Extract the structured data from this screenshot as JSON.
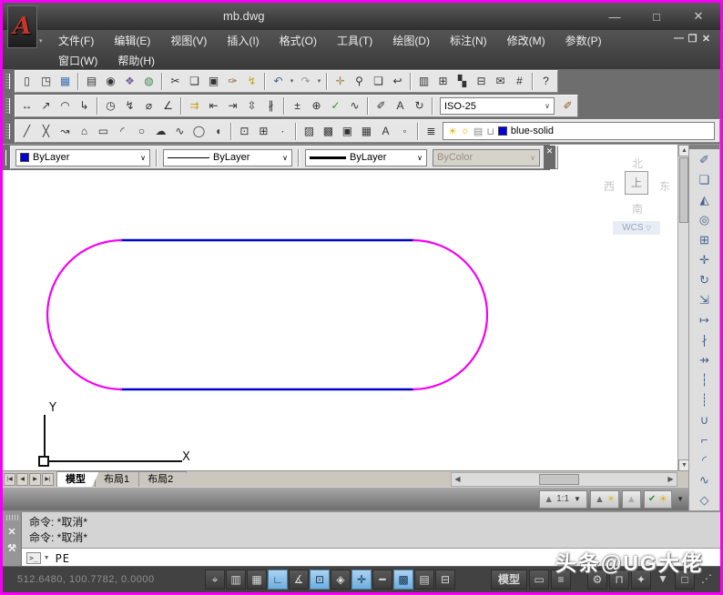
{
  "window": {
    "title": "mb.dwg",
    "logo_letter": "A",
    "logo_dropdown": "▾",
    "minimize": "—",
    "maximize": "□",
    "close": "✕",
    "doc_minimize": "—",
    "doc_restore": "❐",
    "doc_close": "✕"
  },
  "menu": {
    "row1": [
      {
        "name": "menu-file",
        "label": "文件(F)"
      },
      {
        "name": "menu-edit",
        "label": "编辑(E)"
      },
      {
        "name": "menu-view",
        "label": "视图(V)"
      },
      {
        "name": "menu-insert",
        "label": "插入(I)"
      },
      {
        "name": "menu-format",
        "label": "格式(O)"
      },
      {
        "name": "menu-tools",
        "label": "工具(T)"
      },
      {
        "name": "menu-draw",
        "label": "绘图(D)"
      },
      {
        "name": "menu-dimension",
        "label": "标注(N)"
      },
      {
        "name": "menu-modify",
        "label": "修改(M)"
      },
      {
        "name": "menu-parametric",
        "label": "参数(P)"
      }
    ],
    "row2": [
      {
        "name": "menu-window",
        "label": "窗口(W)"
      },
      {
        "name": "menu-help",
        "label": "帮助(H)"
      }
    ]
  },
  "toolbars": {
    "select_chevron": "∨",
    "standard": [
      {
        "name": "new-button",
        "glyph": "▯"
      },
      {
        "name": "open-button",
        "glyph": "◳"
      },
      {
        "name": "save-button",
        "glyph": "▦",
        "color": "#3f6fae"
      },
      {
        "cls": "sep",
        "name": "separator",
        "glyph": ""
      },
      {
        "name": "plot-button",
        "glyph": "▤"
      },
      {
        "name": "plot-preview-button",
        "glyph": "◉"
      },
      {
        "name": "publish-button",
        "glyph": "❖",
        "color": "#7a5fa0"
      },
      {
        "name": "3d-dwf-button",
        "glyph": "◍",
        "color": "#3f8a4f"
      },
      {
        "cls": "sep",
        "name": "separator",
        "glyph": ""
      },
      {
        "name": "cut-button",
        "glyph": "✂"
      },
      {
        "name": "copy-button",
        "glyph": "❏"
      },
      {
        "name": "paste-button",
        "glyph": "▣"
      },
      {
        "name": "match-properties-button",
        "glyph": "✑",
        "color": "#8a5a2a"
      },
      {
        "name": "edit-block-button",
        "glyph": "↯",
        "color": "#c9a227"
      },
      {
        "cls": "sep",
        "name": "separator",
        "glyph": ""
      },
      {
        "name": "undo-button",
        "glyph": "↶",
        "color": "#44618e"
      },
      {
        "name": "undo-dropdown",
        "cls": "narrow",
        "glyph": "▾"
      },
      {
        "name": "redo-button",
        "glyph": "↷",
        "color": "#9a9a9a"
      },
      {
        "name": "redo-dropdown",
        "cls": "narrow",
        "glyph": "▾"
      },
      {
        "cls": "sep",
        "name": "separator",
        "glyph": ""
      },
      {
        "name": "pan-button",
        "glyph": "✛",
        "color": "#a8874f"
      },
      {
        "name": "zoom-realtime-button",
        "glyph": "⚲"
      },
      {
        "name": "zoom-window-button",
        "glyph": "❑"
      },
      {
        "name": "zoom-previous-button",
        "glyph": "↩"
      },
      {
        "cls": "sep",
        "name": "separator",
        "glyph": ""
      },
      {
        "name": "properties-button",
        "glyph": "▥"
      },
      {
        "name": "designcenter-button",
        "glyph": "⊞"
      },
      {
        "name": "tool-palettes-button",
        "glyph": "▚"
      },
      {
        "name": "sheet-set-manager-button",
        "glyph": "⊟"
      },
      {
        "name": "markup-set-manager-button",
        "glyph": "✉"
      },
      {
        "name": "quickcalc-button",
        "glyph": "#"
      },
      {
        "cls": "sep",
        "name": "separator",
        "glyph": ""
      },
      {
        "name": "help-button",
        "glyph": "?"
      }
    ],
    "dimension": [
      {
        "name": "linear-dimension-button",
        "glyph": "↔"
      },
      {
        "name": "aligned-dimension-button",
        "glyph": "↗"
      },
      {
        "name": "arc-length-dimension-button",
        "glyph": "◠"
      },
      {
        "name": "ordinate-dimension-button",
        "glyph": "↳"
      },
      {
        "cls": "sep",
        "name": "separator",
        "glyph": ""
      },
      {
        "name": "radius-dimension-button",
        "glyph": "◷"
      },
      {
        "name": "jogged-dimension-button",
        "glyph": "↯"
      },
      {
        "name": "diameter-dimension-button",
        "glyph": "⌀"
      },
      {
        "name": "angular-dimension-button",
        "glyph": "∠"
      },
      {
        "cls": "sep",
        "name": "separator",
        "glyph": ""
      },
      {
        "name": "quick-dimension-button",
        "glyph": "⇉",
        "color": "#c9a227"
      },
      {
        "name": "baseline-dimension-button",
        "glyph": "⇤"
      },
      {
        "name": "continue-dimension-button",
        "glyph": "⇥"
      },
      {
        "name": "dimension-space-button",
        "glyph": "⇳"
      },
      {
        "name": "dimension-break-button",
        "glyph": "∦"
      },
      {
        "cls": "sep",
        "name": "separator",
        "glyph": ""
      },
      {
        "name": "tolerance-button",
        "glyph": "±"
      },
      {
        "name": "center-mark-button",
        "glyph": "⊕"
      },
      {
        "name": "inspection-button",
        "glyph": "✓",
        "color": "#2f8f2f"
      },
      {
        "name": "jogged-linear-button",
        "glyph": "∿"
      },
      {
        "cls": "sep",
        "name": "separator",
        "glyph": ""
      },
      {
        "name": "dimension-edit-button",
        "glyph": "✐"
      },
      {
        "name": "dimension-text-edit-button",
        "glyph": "A"
      },
      {
        "name": "dimension-update-button",
        "glyph": "↻"
      },
      {
        "cls": "sep",
        "name": "separator",
        "glyph": ""
      }
    ],
    "dimension_style": "ISO-25",
    "dimension_style_button": "✐",
    "draw": [
      {
        "name": "line-button",
        "glyph": "╱"
      },
      {
        "name": "construction-line-button",
        "glyph": "╳"
      },
      {
        "name": "polyline-button",
        "glyph": "↝"
      },
      {
        "name": "polygon-button",
        "glyph": "⌂"
      },
      {
        "name": "rectangle-button",
        "glyph": "▭"
      },
      {
        "name": "arc-button",
        "glyph": "◜"
      },
      {
        "name": "circle-button",
        "glyph": "○"
      },
      {
        "name": "revision-cloud-button",
        "glyph": "☁"
      },
      {
        "name": "spline-button",
        "glyph": "∿"
      },
      {
        "name": "ellipse-button",
        "glyph": "◯"
      },
      {
        "name": "ellipse-arc-button",
        "glyph": "◖"
      },
      {
        "cls": "sep",
        "name": "separator",
        "glyph": ""
      },
      {
        "name": "insert-block-button",
        "glyph": "⊡"
      },
      {
        "name": "make-block-button",
        "glyph": "⊞"
      },
      {
        "name": "point-button",
        "glyph": "∙"
      },
      {
        "cls": "sep",
        "name": "separator",
        "glyph": ""
      },
      {
        "name": "hatch-button",
        "glyph": "▨"
      },
      {
        "name": "gradient-button",
        "glyph": "▩"
      },
      {
        "name": "region-button",
        "glyph": "▣"
      },
      {
        "name": "table-button",
        "glyph": "▦"
      },
      {
        "name": "multiline-text-button",
        "glyph": "A"
      },
      {
        "name": "point-style-button",
        "glyph": "◦"
      }
    ],
    "layers": {
      "manager_glyph": "≣",
      "on_glyph": "☀",
      "thaw_glyph": "☼",
      "plot_glyph": "▤",
      "lock_glyph": "⊔",
      "swatch": "#0000dd",
      "value": "blue-solid"
    },
    "properties": {
      "color_swatch": "#0000dd",
      "color_value": "ByLayer",
      "linetype_value": "ByLayer",
      "lineweight_value": "ByLayer",
      "plotstyle_value": "ByColor",
      "close_glyph": "✕"
    },
    "modify": [
      {
        "name": "erase-button",
        "glyph": "✐"
      },
      {
        "name": "copy-button",
        "glyph": "❏"
      },
      {
        "name": "mirror-button",
        "glyph": "◭"
      },
      {
        "name": "offset-button",
        "glyph": "◎"
      },
      {
        "name": "array-button",
        "glyph": "⊞"
      },
      {
        "name": "move-button",
        "glyph": "✛"
      },
      {
        "name": "rotate-button",
        "glyph": "↻"
      },
      {
        "name": "scale-button",
        "glyph": "⇲"
      },
      {
        "name": "stretch-button",
        "glyph": "↦"
      },
      {
        "name": "trim-button",
        "glyph": "∤"
      },
      {
        "name": "extend-button",
        "glyph": "⇸"
      },
      {
        "name": "break-at-point-button",
        "glyph": "┆"
      },
      {
        "name": "break-button",
        "glyph": "┊"
      },
      {
        "name": "join-button",
        "glyph": "∪"
      },
      {
        "name": "chamfer-button",
        "glyph": "⌐"
      },
      {
        "name": "fillet-button",
        "glyph": "◜"
      },
      {
        "name": "blend-curves-button",
        "glyph": "∿"
      },
      {
        "name": "explode-button",
        "glyph": "◇"
      }
    ]
  },
  "viewcube": {
    "north": "北",
    "west": "西",
    "top": "上",
    "east": "东",
    "south": "南",
    "wcs": "WCS",
    "wcs_arrow": "▽"
  },
  "ucs": {
    "x_label": "X",
    "y_label": "Y"
  },
  "tabs": {
    "nav": [
      {
        "name": "tab-first-button",
        "glyph": "|◀"
      },
      {
        "name": "tab-prev-button",
        "glyph": "◀"
      },
      {
        "name": "tab-next-button",
        "glyph": "▶"
      },
      {
        "name": "tab-last-button",
        "glyph": "▶|"
      }
    ],
    "items": [
      {
        "name": "tab-model",
        "label": "模型",
        "active": true
      },
      {
        "name": "tab-layout1",
        "label": "布局1"
      },
      {
        "name": "tab-layout2",
        "label": "布局2"
      }
    ]
  },
  "scrollbars": {
    "up": "▲",
    "down": "▼",
    "left": "◀",
    "right": "▶"
  },
  "annotation": {
    "scale_icon": "▲",
    "scale": "1:1",
    "dropdown": "▼",
    "visibility_icon": "▲",
    "visibility_bulb": "☀",
    "autoscale_icon": "▲",
    "layer_check": "✔",
    "layer_bulb": "☀",
    "menu_arrow": "▼"
  },
  "command": {
    "close_glyph": "✕",
    "tool_glyph": "⚒",
    "history": [
      "命令: *取消*",
      "命令: *取消*"
    ],
    "prompt": ">_",
    "dropdown": "▼",
    "input": "PE"
  },
  "status": {
    "coordinates": "512.6480, 100.7782, 0.0000",
    "toggles": [
      {
        "name": "infer-constraints-toggle",
        "glyph": "⌖"
      },
      {
        "name": "snap-toggle",
        "glyph": "▥"
      },
      {
        "name": "grid-toggle",
        "glyph": "▦"
      },
      {
        "name": "ortho-toggle",
        "glyph": "∟",
        "active": true
      },
      {
        "name": "polar-tracking-toggle",
        "glyph": "∡"
      },
      {
        "name": "object-snap-toggle",
        "glyph": "⊡",
        "active": true
      },
      {
        "name": "3d-object-snap-toggle",
        "glyph": "◈"
      },
      {
        "name": "dynamic-input-toggle",
        "glyph": "✛",
        "active": true
      },
      {
        "name": "lineweight-toggle",
        "glyph": "━"
      },
      {
        "name": "transparency-toggle",
        "glyph": "▩",
        "active": true
      },
      {
        "name": "quick-properties-toggle",
        "glyph": "▤"
      },
      {
        "name": "selection-cycling-toggle",
        "glyph": "⊟"
      }
    ],
    "right": [
      {
        "name": "model-space-button",
        "glyph": "模型",
        "cls": "txt"
      },
      {
        "name": "annotation-monitor-button",
        "glyph": "▭"
      },
      {
        "name": "tray-settings-button",
        "glyph": "≡"
      },
      {
        "name": "workspace-switching-button",
        "glyph": "⚙",
        "cls": "gapL"
      },
      {
        "name": "toolbar-lock-button",
        "glyph": "⊓"
      },
      {
        "name": "hardware-acceleration-button",
        "glyph": "✦"
      },
      {
        "name": "status-menu-button",
        "glyph": "▼",
        "cls": "plain"
      },
      {
        "name": "clean-screen-button",
        "glyph": "□"
      },
      {
        "name": "resize-grip",
        "glyph": "⋰",
        "cls": "plain"
      }
    ]
  },
  "watermark": "头条@UG大佬",
  "colors": {
    "magenta": "#f400f4",
    "blue": "#0000c8"
  }
}
